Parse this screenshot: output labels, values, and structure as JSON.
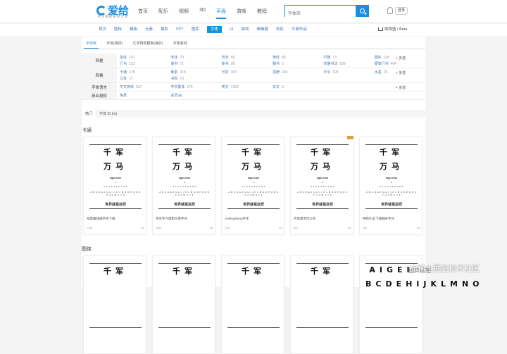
{
  "header": {
    "logo_text": "爱给",
    "logo_sub": "专注免费素材分享",
    "nav": [
      "首页",
      "配乐",
      "视频",
      "3D",
      "平面",
      "游戏",
      "教程"
    ],
    "active_nav": 4,
    "search_placeholder": "字体库",
    "login_label": "登录"
  },
  "subnav": {
    "items": [
      "首页",
      "图标",
      "模板",
      "元素",
      "摄影",
      "PPT",
      "图库",
      "字体",
      "UI",
      "游戏",
      "编辑器",
      "欢影",
      "平面作品"
    ],
    "active": 7,
    "cart_label": "购物篮 / Beta"
  },
  "tabs": [
    "字体库",
    "字体(简体)",
    "文字特效模板(海外)",
    "字体素材"
  ],
  "filters": {
    "rows": [
      {
        "label": "风格",
        "values": [
          {
            "name": "黑体",
            "count": "191"
          },
          {
            "name": "宋体",
            "count": "79"
          },
          {
            "name": "仿宋",
            "count": "49"
          },
          {
            "name": "楷体",
            "count": "89"
          },
          {
            "name": "行楷",
            "count": "73"
          },
          {
            "name": "圆体",
            "count": "145"
          },
          {
            "name": "行书",
            "count": "123"
          },
          {
            "name": "隶书",
            "count": "71"
          },
          {
            "name": "篆书",
            "count": "28"
          },
          {
            "name": "魏书",
            "count": "5"
          },
          {
            "name": "宋雕书法",
            "count": "209"
          },
          {
            "name": "硬笔行书",
            "count": "464"
          }
        ]
      },
      {
        "label": "风格",
        "values": [
          {
            "name": "卡通",
            "count": "278"
          },
          {
            "name": "像素",
            "count": "318"
          },
          {
            "name": "可爱",
            "count": "300"
          },
          {
            "name": "招牌",
            "count": "294"
          },
          {
            "name": "手写",
            "count": "195"
          },
          {
            "name": "水墨",
            "count": "25"
          },
          {
            "name": "立体",
            "count": "21"
          },
          {
            "name": "书码",
            "count": "10"
          }
        ]
      },
      {
        "label": "字体语言",
        "values": [
          {
            "name": "中文简体",
            "count": "537"
          },
          {
            "name": "中文繁体",
            "count": "176"
          },
          {
            "name": "英文",
            "count": "7123"
          },
          {
            "name": "日文",
            "count": "6"
          }
        ]
      },
      {
        "label": "商业授权",
        "values": [
          {
            "name": "免费",
            "count": ""
          },
          {
            "name": "会员vip",
            "count": ""
          }
        ]
      }
    ],
    "more_label": "+ 多选"
  },
  "list_tabs": [
    "热门",
    "字体 (5.1w)"
  ],
  "sections": [
    {
      "title": "卡通",
      "cards": [
        {
          "g1": "千军",
          "g2": "万马",
          "site": "aigei.com",
          "name": "经典趣味圆字体下载",
          "views": "1786",
          "likes": "9m",
          "vip": false
        },
        {
          "g1": "千军",
          "g2": "万马",
          "site": "aigei.com",
          "name": "青鸟字元圆粗头像字体",
          "views": "1685",
          "likes": "9m",
          "vip": false
        },
        {
          "g1": "千军",
          "g2": "万马",
          "site": "aigei.com",
          "name": "AafengMeng字体",
          "views": "1784",
          "likes": "9m",
          "vip": false
        },
        {
          "g1": "千军",
          "g2": "万马",
          "site": "aigei.com",
          "name": "折角粗黑体头条",
          "views": "520",
          "likes": "9m",
          "vip": true
        },
        {
          "g1": "千军",
          "g2": "万马",
          "site": "aigei.com",
          "name": "拼积孔是卡通圆形字体",
          "views": "162",
          "likes": "9m",
          "vip": false
        }
      ]
    },
    {
      "title": "圆体",
      "cards": [
        {
          "g1": "千军",
          "g2": "",
          "site": "",
          "name": "",
          "views": "",
          "likes": "",
          "vip": false
        },
        {
          "g1": "千军",
          "g2": "",
          "site": "",
          "name": "",
          "views": "",
          "likes": "",
          "vip": false
        },
        {
          "g1": "千军",
          "g2": "",
          "site": "",
          "name": "",
          "views": "",
          "likes": "",
          "vip": false
        },
        {
          "g1": "千军",
          "g2": "",
          "site": "",
          "name": "",
          "views": "",
          "likes": "",
          "vip": false
        },
        {
          "g1": "AIGEI",
          "g2": "BCDEHIJKLMNO",
          "site": "",
          "name": "",
          "views": "",
          "likes": "",
          "vip": false
        }
      ]
    }
  ],
  "card_common": {
    "x": "x",
    "nums": "0 1 2 3 4 5 6 7 8 9",
    "alpha": "A B C D E F G H I J K L M N O P Q R S T U V W X Y Z",
    "cn": "世界就是这样"
  },
  "watermark": "@稀土掘金技术社区",
  "watermark2": "抛弃前端"
}
